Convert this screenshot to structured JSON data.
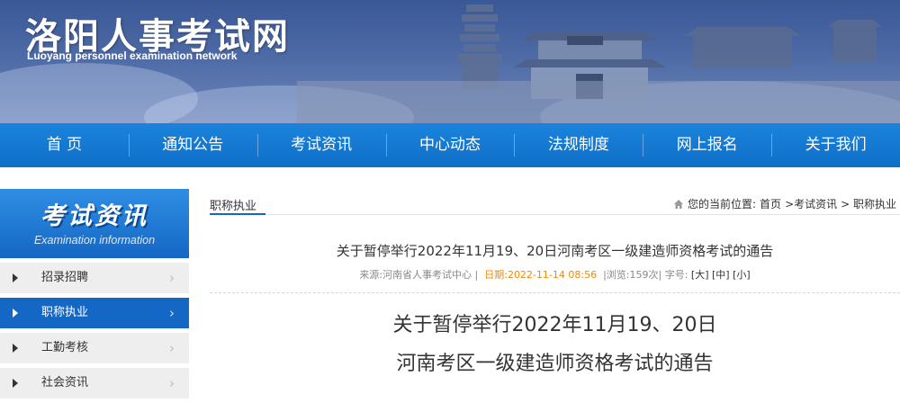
{
  "header": {
    "title": "洛阳人事考试网",
    "subtitle": "Luoyang personnel examination network"
  },
  "nav": [
    "首 页",
    "通知公告",
    "考试资讯",
    "中心动态",
    "法规制度",
    "网上报名",
    "关于我们"
  ],
  "sidebar": {
    "title": "考试资讯",
    "subtitle": "Examination information",
    "items": [
      {
        "label": "招录招聘",
        "active": false
      },
      {
        "label": "职称执业",
        "active": true
      },
      {
        "label": "工勤考核",
        "active": false
      },
      {
        "label": "社会资讯",
        "active": false
      }
    ]
  },
  "main": {
    "section_title": "职称执业",
    "breadcrumb": {
      "prefix": "您的当前位置:",
      "home": "首页",
      "sep1": ">考试资讯",
      "sep2": "> 职称执业"
    },
    "article": {
      "title": "关于暂停举行2022年11月19、20日河南考区一级建造师资格考试的通告",
      "source": "来源:河南省人事考试中心 |",
      "date": "日期:2022-11-14 08:56",
      "views": "|浏览:159次| 字号:",
      "font_large": "[大]",
      "font_medium": "[中]",
      "font_small": "[小]",
      "headline_line1": "关于暂停举行2022年11月19、20日",
      "headline_line2": "河南考区一级建造师资格考试的通告"
    }
  },
  "colors": {
    "nav": "#0f6fc7",
    "active": "#1467c4",
    "date": "#f08a00"
  }
}
